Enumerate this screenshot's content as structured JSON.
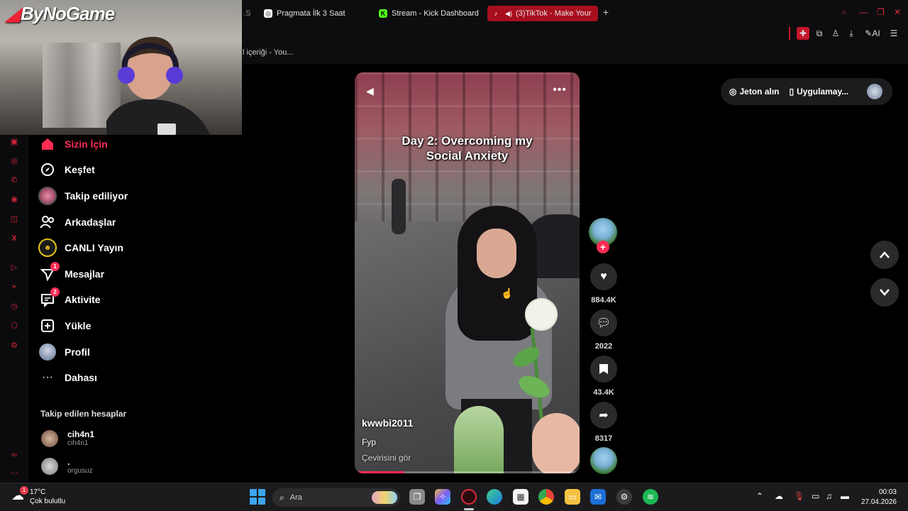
{
  "browser": {
    "tabs": [
      {
        "title": "Pragmatа İlk 3 Saat",
        "icon": "chatgpt-icon"
      },
      {
        "title": "Stream - Kick Dashboard",
        "icon": "kick-icon"
      },
      {
        "title": "(3)TikTok - Make Your",
        "icon": "tiktok-icon",
        "active": true
      }
    ],
    "partial_tab_text": "S",
    "bookmark_text": "l içeriği - You...",
    "ai_label": "AI"
  },
  "webcam": {
    "brand": "ByNoGame"
  },
  "sidebar": {
    "items": [
      {
        "label": "Sizin İçin",
        "icon": "home-icon",
        "active": true
      },
      {
        "label": "Keşfet",
        "icon": "compass-icon"
      },
      {
        "label": "Takip ediliyor",
        "icon": "following-avatar-icon"
      },
      {
        "label": "Arkadaşlar",
        "icon": "friends-icon"
      },
      {
        "label": "CANLI Yayın",
        "icon": "live-icon"
      },
      {
        "label": "Mesajlar",
        "icon": "messages-icon",
        "badge": "1"
      },
      {
        "label": "Aktivite",
        "icon": "activity-icon",
        "badge": "2"
      },
      {
        "label": "Yükle",
        "icon": "upload-icon"
      },
      {
        "label": "Profil",
        "icon": "profile-icon"
      },
      {
        "label": "Dahası",
        "icon": "more-icon"
      }
    ],
    "following_title": "Takip edilen hesaplar",
    "accounts": [
      {
        "name": "cih4n1",
        "handle": "cih4n1"
      },
      {
        "name": ".",
        "handle": "orgusuz"
      }
    ]
  },
  "video": {
    "title_line1": "Day 2: Overcoming my",
    "title_line2": "Social Anxiety",
    "author": "kwwbi2011",
    "caption": "Fyp",
    "translate": "Çevirisini gör",
    "progress": 0.22
  },
  "actions": {
    "likes": "884.4K",
    "comments": "2022",
    "saves": "43.4K",
    "shares": "8317"
  },
  "top_right": {
    "coins": "Jeton alın",
    "app": "Uygulamay..."
  },
  "taskbar": {
    "weather_temp": "17°C",
    "weather_desc": "Çok bulutlu",
    "weather_badge": "1",
    "search_placeholder": "Ara",
    "time": "00:03",
    "date": "27.04.2026"
  },
  "colors": {
    "accent": "#fe2c55",
    "active_tab": "#a80f1e",
    "rail_icon": "#d2263a"
  }
}
